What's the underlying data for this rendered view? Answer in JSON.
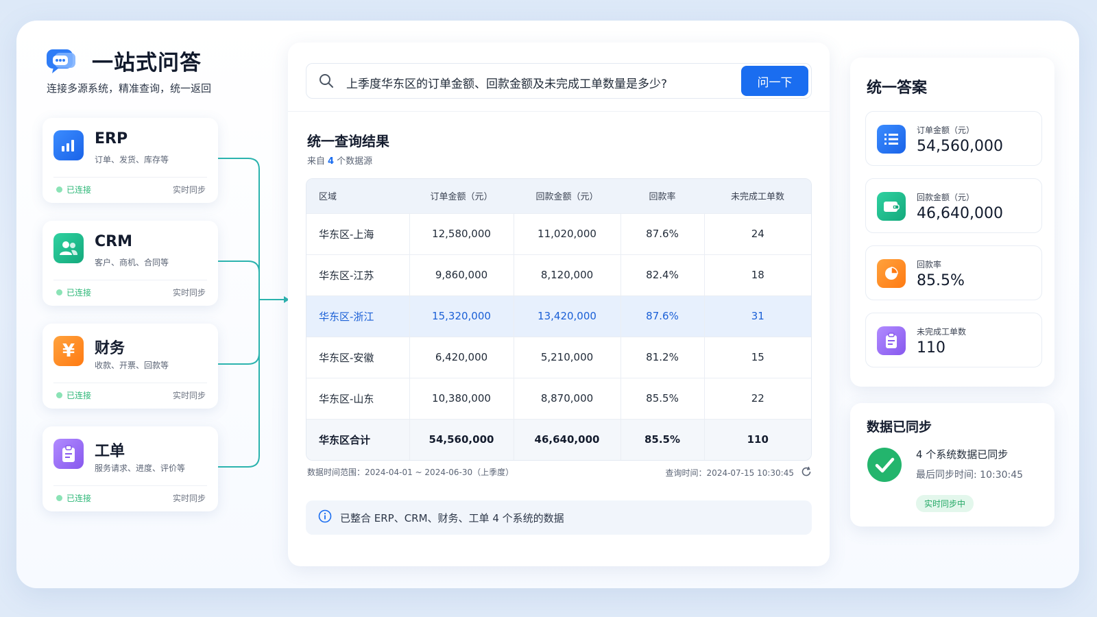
{
  "brand": {
    "title": "一站式问答",
    "subtitle": "连接多源系统，精准查询，统一返回"
  },
  "sources": [
    {
      "name": "ERP",
      "desc": "订单、发货、库存等",
      "status": "已连接",
      "sync": "实时同步",
      "color": "#2e7cf6",
      "icon": "bar-chart-icon"
    },
    {
      "name": "CRM",
      "desc": "客户、商机、合同等",
      "status": "已连接",
      "sync": "实时同步",
      "color": "#1fbf8f",
      "icon": "users-icon"
    },
    {
      "name": "财务",
      "desc": "收款、开票、回款等",
      "status": "已连接",
      "sync": "实时同步",
      "color": "#ff8a1f",
      "icon": "yen-icon"
    },
    {
      "name": "工单",
      "desc": "服务请求、进度、评价等",
      "status": "已连接",
      "sync": "实时同步",
      "color": "#9a6bf2",
      "icon": "clipboard-icon"
    }
  ],
  "search": {
    "query": "上季度华东区的订单金额、回款金额及未完成工单数量是多少?",
    "button": "问一下"
  },
  "result": {
    "title": "统一查询结果",
    "source_prefix": "来自",
    "source_count": "4",
    "source_suffix": "个数据源",
    "columns": [
      "区域",
      "订单金额（元）",
      "回款金额（元）",
      "回款率",
      "未完成工单数"
    ],
    "rows": [
      [
        "华东区-上海",
        "12,580,000",
        "11,020,000",
        "87.6%",
        "24"
      ],
      [
        "华东区-江苏",
        "9,860,000",
        "8,120,000",
        "82.4%",
        "18"
      ],
      [
        "华东区-浙江",
        "15,320,000",
        "13,420,000",
        "87.6%",
        "31"
      ],
      [
        "华东区-安徽",
        "6,420,000",
        "5,210,000",
        "81.2%",
        "15"
      ],
      [
        "华东区-山东",
        "10,380,000",
        "8,870,000",
        "85.5%",
        "22"
      ]
    ],
    "highlight_row": 2,
    "total": [
      "华东区合计",
      "54,560,000",
      "46,640,000",
      "85.5%",
      "110"
    ],
    "range": "数据时间范围：2024-04-01 ~ 2024-06-30（上季度）",
    "query_time": "查询时间：2024-07-15 10:30:45",
    "note": "已整合 ERP、CRM、财务、工单 4 个系统的数据"
  },
  "answer": {
    "title": "统一答案",
    "metrics": [
      {
        "label": "订单金额（元）",
        "value": "54,560,000",
        "color": "#2e7cf6",
        "icon": "list-icon"
      },
      {
        "label": "回款金额（元）",
        "value": "46,640,000",
        "color": "#1fbf8f",
        "icon": "wallet-icon"
      },
      {
        "label": "回款率",
        "value": "85.5%",
        "color": "#ff8a1f",
        "icon": "pie-chart-icon"
      },
      {
        "label": "未完成工单数",
        "value": "110",
        "color": "#9a6bf2",
        "icon": "clipboard-icon"
      }
    ]
  },
  "sync": {
    "title": "数据已同步",
    "line1": "4 个系统数据已同步",
    "line2": "最后同步时间: 10:30:45",
    "badge": "实时同步中"
  }
}
